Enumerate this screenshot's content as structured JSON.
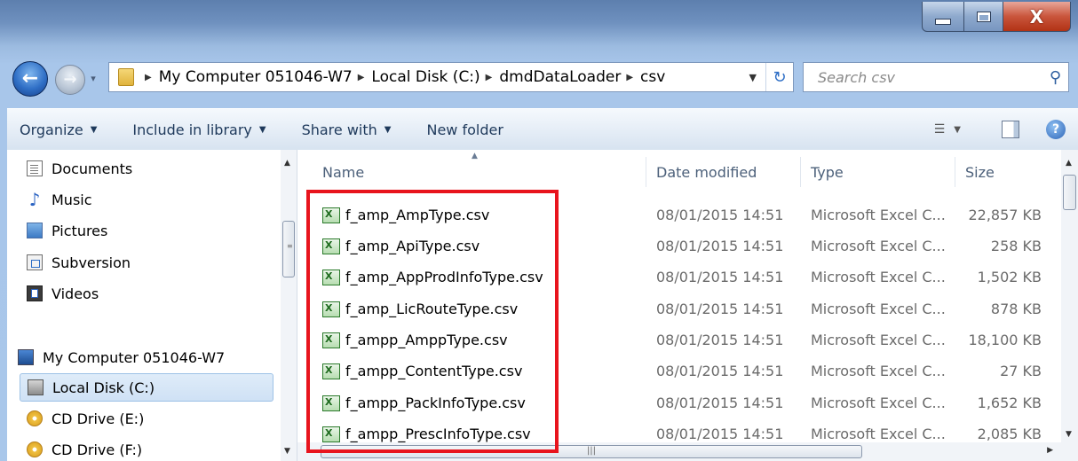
{
  "window": {
    "close_glyph": "X"
  },
  "nav": {
    "breadcrumbs": [
      "My Computer 051046-W7",
      "Local Disk (C:)",
      "dmdDataLoader",
      "csv"
    ],
    "search_placeholder": "Search csv"
  },
  "toolbar": {
    "organize": "Organize",
    "include_in_library": "Include in library",
    "share_with": "Share with",
    "new_folder": "New folder"
  },
  "sidebar": {
    "items": [
      {
        "label": "Documents",
        "icon": "documents-icon"
      },
      {
        "label": "Music",
        "icon": "music-icon"
      },
      {
        "label": "Pictures",
        "icon": "pictures-icon"
      },
      {
        "label": "Subversion",
        "icon": "subversion-icon"
      },
      {
        "label": "Videos",
        "icon": "videos-icon"
      },
      {
        "label": "My Computer 051046-W7",
        "icon": "computer-icon"
      },
      {
        "label": "Local Disk (C:)",
        "icon": "disk-icon",
        "selected": true
      },
      {
        "label": "CD Drive (E:)",
        "icon": "cd-icon"
      },
      {
        "label": "CD Drive (F:)",
        "icon": "cd-icon"
      }
    ]
  },
  "files": {
    "columns": [
      "Name",
      "Date modified",
      "Type",
      "Size"
    ],
    "rows": [
      {
        "name": "f_amp_AmpType.csv",
        "date": "08/01/2015 14:51",
        "type": "Microsoft Excel C...",
        "size": "22,857 KB"
      },
      {
        "name": "f_amp_ApiType.csv",
        "date": "08/01/2015 14:51",
        "type": "Microsoft Excel C...",
        "size": "258 KB"
      },
      {
        "name": "f_amp_AppProdInfoType.csv",
        "date": "08/01/2015 14:51",
        "type": "Microsoft Excel C...",
        "size": "1,502 KB"
      },
      {
        "name": "f_amp_LicRouteType.csv",
        "date": "08/01/2015 14:51",
        "type": "Microsoft Excel C...",
        "size": "878 KB"
      },
      {
        "name": "f_ampp_AmppType.csv",
        "date": "08/01/2015 14:51",
        "type": "Microsoft Excel C...",
        "size": "18,100 KB"
      },
      {
        "name": "f_ampp_ContentType.csv",
        "date": "08/01/2015 14:51",
        "type": "Microsoft Excel C...",
        "size": "27 KB"
      },
      {
        "name": "f_ampp_PackInfoType.csv",
        "date": "08/01/2015 14:51",
        "type": "Microsoft Excel C...",
        "size": "1,652 KB"
      },
      {
        "name": "f_ampp_PrescInfoType.csv",
        "date": "08/01/2015 14:51",
        "type": "Microsoft Excel C...",
        "size": "2,085 KB"
      }
    ]
  },
  "colors": {
    "highlight": "#e8141d",
    "accent": "#2f6fc6"
  }
}
